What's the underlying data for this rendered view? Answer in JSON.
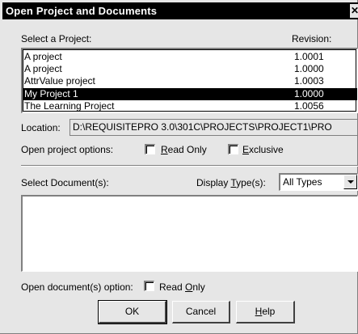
{
  "dialog": {
    "title": "Open Project and Documents",
    "close_glyph": "✕"
  },
  "projects": {
    "label": "Select a Project:",
    "revision_header": "Revision:",
    "rows": [
      {
        "name": "A project",
        "revision": "1.0001"
      },
      {
        "name": "A project",
        "revision": "1.0000"
      },
      {
        "name": "AttrValue project",
        "revision": "1.0003"
      },
      {
        "name": "My Project 1",
        "revision": "1.0000",
        "selected": true
      },
      {
        "name": "The Learning Project",
        "revision": "1.0056"
      }
    ]
  },
  "location": {
    "label": "Location:",
    "value": "D:\\REQUISITEPRO 3.0\\301C\\PROJECTS\\PROJECT1\\PRO"
  },
  "project_options": {
    "label": "Open project options:",
    "read_only_pre": "",
    "read_only_u": "R",
    "read_only_post": "ead Only",
    "read_only_checked": false,
    "exclusive_pre": "",
    "exclusive_u": "E",
    "exclusive_post": "xclusive",
    "exclusive_checked": false
  },
  "documents": {
    "label": "Select Document(s):",
    "type_label_pre": "Display ",
    "type_label_u": "T",
    "type_label_post": "ype(s):",
    "type_value": "All Types"
  },
  "document_options": {
    "label": "Open document(s) option:",
    "read_only_pre": "Read ",
    "read_only_u": "O",
    "read_only_post": "nly",
    "read_only_checked": false
  },
  "buttons": {
    "ok": "OK",
    "cancel": "Cancel",
    "help_u": "H",
    "help_post": "elp"
  },
  "colors": {
    "selection_bg": "#000000",
    "selection_fg": "#ffffff",
    "dialog_bg": "#e6e6e6"
  }
}
